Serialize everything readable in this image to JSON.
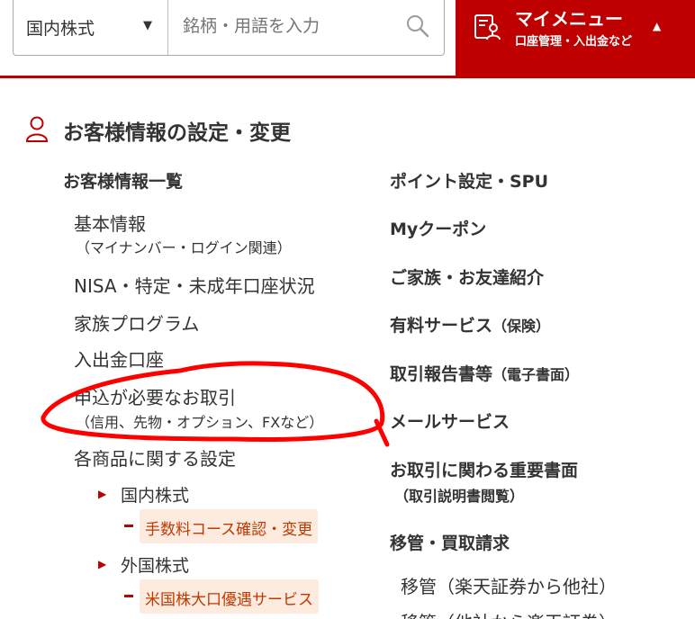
{
  "search": {
    "market_select": "国内株式",
    "placeholder": "銘柄・用語を入力"
  },
  "my_menu": {
    "title": "マイメニュー",
    "subtitle": "口座管理・入出金など"
  },
  "heading": "お客様情報の設定・変更",
  "left": {
    "section_title": "お客様情報一覧",
    "items": [
      {
        "label": "基本情報",
        "note": "（マイナンバー・ログイン関連）"
      },
      {
        "label": "NISA・特定・未成年口座状況"
      },
      {
        "label": "家族プログラム"
      },
      {
        "label": "入出金口座"
      },
      {
        "label": "申込が必要なお取引",
        "note": "（信用、先物・オプション、FXなど）"
      },
      {
        "label": "各商品に関する設定"
      }
    ],
    "products": [
      {
        "label": "国内株式",
        "sub": "手数料コース確認・変更"
      },
      {
        "label": "外国株式",
        "sub": "米国株大口優遇サービス"
      }
    ]
  },
  "right": {
    "items": [
      {
        "label": "ポイント設定・SPU"
      },
      {
        "label": "Myクーポン"
      },
      {
        "label": "ご家族・お友達紹介"
      },
      {
        "label": "有料サービス",
        "note": "（保険）"
      },
      {
        "label": "取引報告書等",
        "note": "（電子書面）"
      },
      {
        "label": "メールサービス"
      },
      {
        "label": "お取引に関わる重要書面",
        "note": "（取引説明書閲覧）"
      },
      {
        "label": "移管・買取請求"
      }
    ],
    "transfer_links": [
      "移管（楽天証券から他社）",
      "移管（他社から楽天証券）"
    ]
  },
  "colors": {
    "brand_red": "#bf0000",
    "sub_link_bg": "#fdebe0",
    "annotation_red": "#ff0000"
  }
}
